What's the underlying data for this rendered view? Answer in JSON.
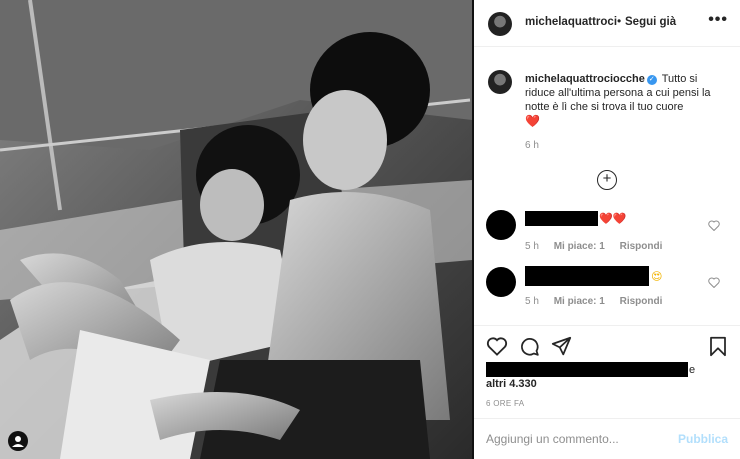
{
  "post": {
    "username": "michelaquattrociocche",
    "follow_dot": "•",
    "follow_label": "Segui già",
    "more_label": "•••",
    "verified_mark": "✓",
    "caption_text": "Tutto si riduce all'ultima persona a cui pensi la notte è lì che si trova il tuo cuore",
    "caption_emoji": "❤️",
    "caption_time": "6 h",
    "load_more_label": "+",
    "likes_suffix": "e",
    "likes_text": "altri 4.330",
    "post_time": "6 ORE FA"
  },
  "comments": [
    {
      "emoji": "❤️❤️",
      "time": "5 h",
      "likes": "Mi piace: 1",
      "reply": "Rispondi"
    },
    {
      "emoji": "😍",
      "time": "5 h",
      "likes": "Mi piace: 1",
      "reply": "Rispondi"
    }
  ],
  "composer": {
    "placeholder": "Aggiungi un commento...",
    "publish_label": "Pubblica"
  },
  "icons": {
    "like": "heart-icon",
    "comment": "comment-icon",
    "share": "share-icon",
    "save": "bookmark-icon",
    "comment_like": "heart-icon",
    "tag": "user-tag-icon"
  },
  "colors": {
    "verified": "#3897f0",
    "publish": "#b2dffc",
    "muted": "#8e8e8e"
  }
}
